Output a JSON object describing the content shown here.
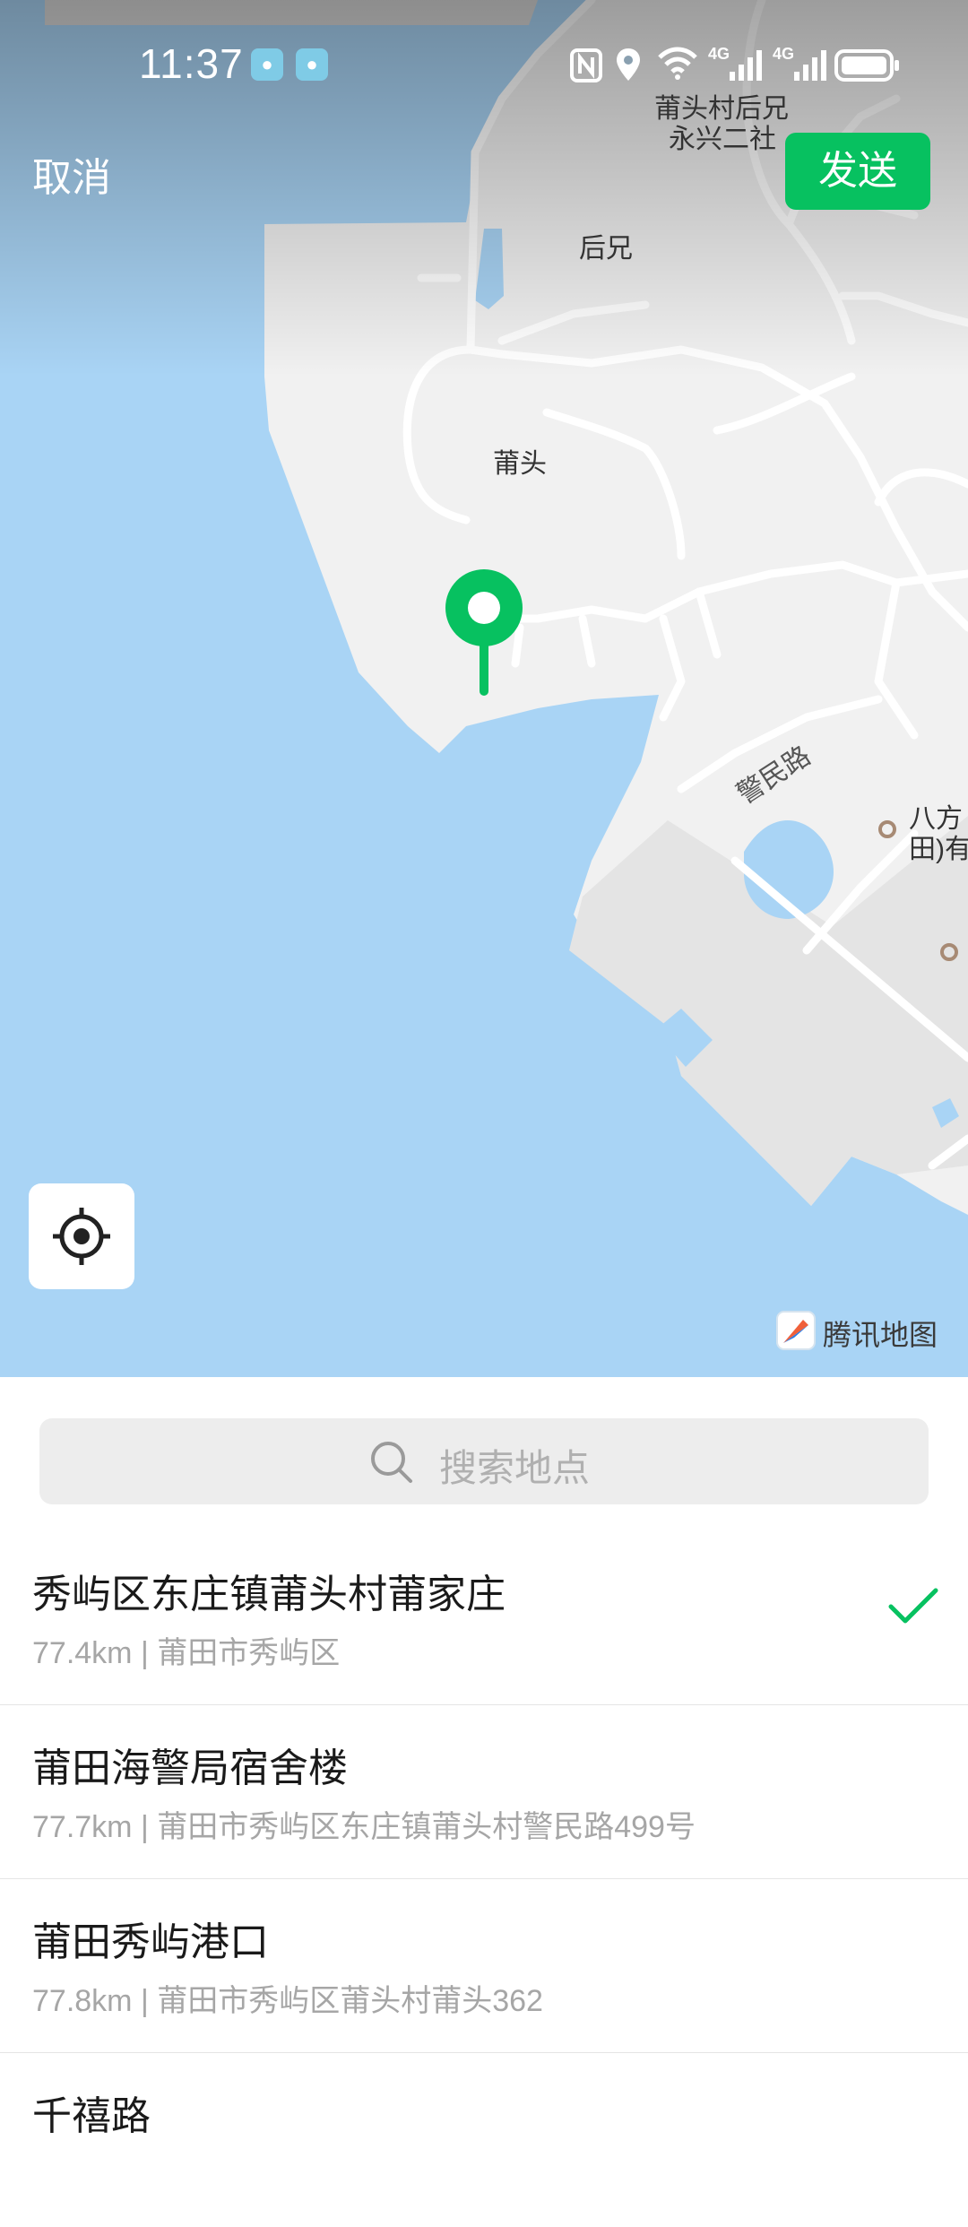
{
  "status_bar": {
    "time": "11:37",
    "icons": [
      "app-notification-icon",
      "app-notification-icon",
      "nfc-icon",
      "location-icon",
      "wifi-icon",
      "signal-4g-icon",
      "signal-4g-icon",
      "battery-icon"
    ],
    "network_label_1": "4G",
    "network_label_2": "4G"
  },
  "top_bar": {
    "cancel_label": "取消",
    "send_label": "发送"
  },
  "map": {
    "labels": {
      "village_line1": "莆头村后兄",
      "village_line2": "永兴二社",
      "houxiong": "后兄",
      "putou": "莆头",
      "road": "警民路",
      "poi_line1": "八方",
      "poi_line2": "田)有"
    },
    "watermark": "腾讯地图",
    "colors": {
      "water": "#a9d4f5",
      "land": "#f1f1f1",
      "accent": "#07c160"
    }
  },
  "search": {
    "placeholder": "搜索地点"
  },
  "results": [
    {
      "name": "秀屿区东庄镇莆头村莆家庄",
      "distance": "77.4km",
      "address": "莆田市秀屿区",
      "selected": true
    },
    {
      "name": "莆田海警局宿舍楼",
      "distance": "77.7km",
      "address": "莆田市秀屿区东庄镇莆头村警民路499号",
      "selected": false
    },
    {
      "name": "莆田秀屿港口",
      "distance": "77.8km",
      "address": "莆田市秀屿区莆头村莆头362",
      "selected": false
    },
    {
      "name": "千禧路",
      "distance": "",
      "address": "",
      "selected": false
    }
  ]
}
